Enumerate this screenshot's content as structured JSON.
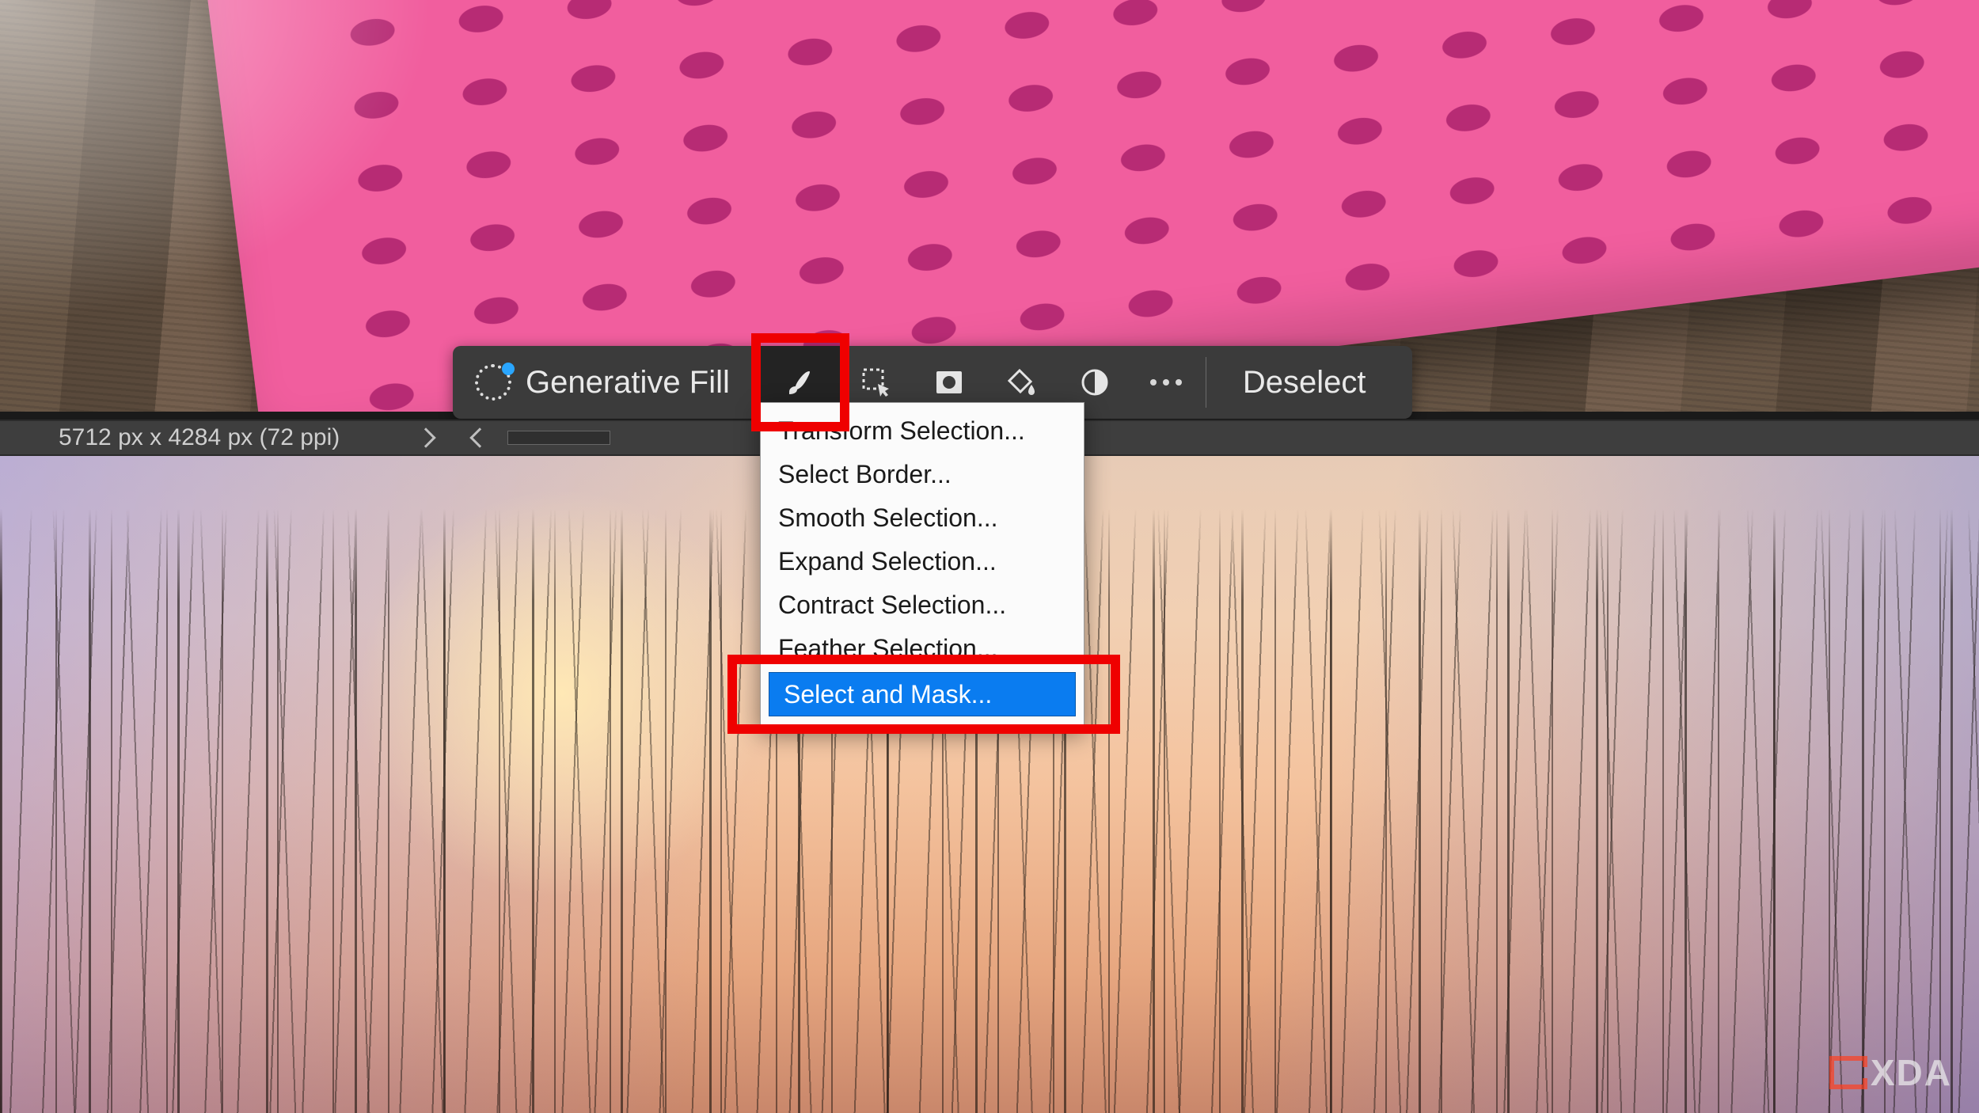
{
  "taskbar": {
    "generative_fill_label": "Generative Fill",
    "deselect_label": "Deselect",
    "icons": {
      "generative": "generative-fill-icon",
      "brush": "brush-icon",
      "selection_more": "selection-modify-icon",
      "mask": "mask-icon",
      "fill": "fill-bucket-icon",
      "adjust": "contrast-circle-icon",
      "more": "more-icon"
    }
  },
  "menu": {
    "items": [
      "Transform Selection...",
      "Select Border...",
      "Smooth Selection...",
      "Expand Selection...",
      "Contract Selection...",
      "Feather Selection...",
      "Select and Mask..."
    ],
    "highlighted_index": 6
  },
  "footer": {
    "dimensions": "5712 px x 4284 px (72 ppi)"
  },
  "annotation": {
    "highlight_1": "brush-tool-button",
    "highlight_2": "select-and-mask-menu-item"
  },
  "watermark": "XDA"
}
